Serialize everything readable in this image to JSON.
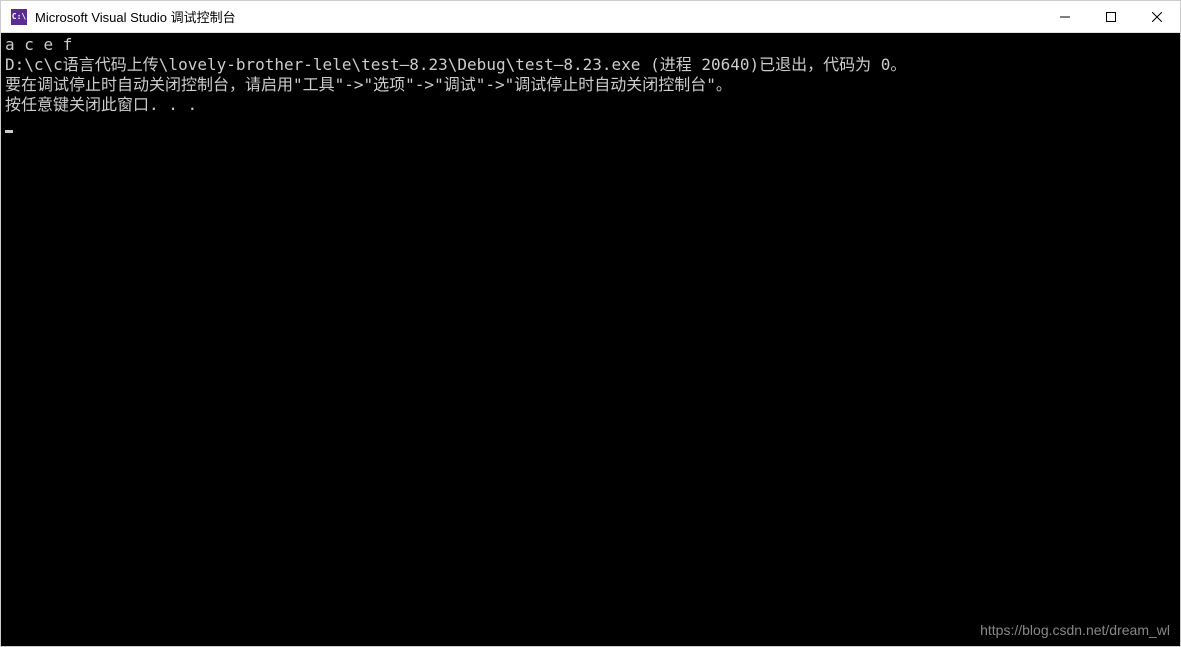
{
  "window": {
    "title": "Microsoft Visual Studio 调试控制台",
    "icon_text": "C:\\"
  },
  "console": {
    "lines": [
      "a c e f",
      "D:\\c\\c语言代码上传\\lovely-brother-lele\\test—8.23\\Debug\\test—8.23.exe (进程 20640)已退出，代码为 0。",
      "要在调试停止时自动关闭控制台，请启用\"工具\"->\"选项\"->\"调试\"->\"调试停止时自动关闭控制台\"。",
      "按任意键关闭此窗口. . ."
    ]
  },
  "watermark": "https://blog.csdn.net/dream_wl"
}
